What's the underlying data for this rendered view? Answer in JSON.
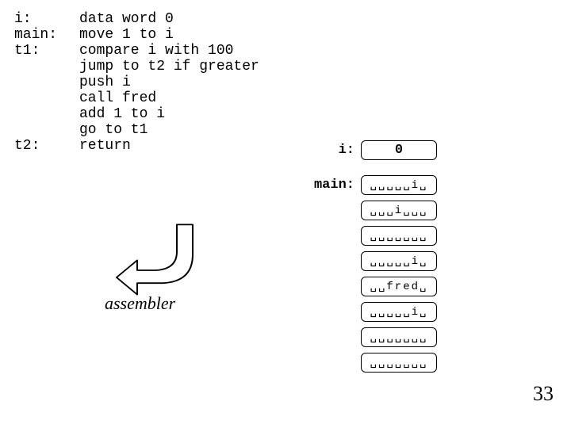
{
  "code": {
    "rows": [
      {
        "label": "i:",
        "instr": "data word 0"
      },
      {
        "label": "main:",
        "instr": "move 1 to i"
      },
      {
        "label": "t1:",
        "instr": "compare i with 100"
      },
      {
        "label": "",
        "instr": "jump to t2 if greater"
      },
      {
        "label": "",
        "instr": "push i"
      },
      {
        "label": "",
        "instr": "call fred"
      },
      {
        "label": "",
        "instr": "add 1 to i"
      },
      {
        "label": "",
        "instr": "go to t1"
      },
      {
        "label": "t2:",
        "instr": "return"
      }
    ]
  },
  "assembler_caption": "assembler",
  "memory": {
    "cells": [
      {
        "label": "i:",
        "content": "0",
        "first": true
      },
      {
        "label": "",
        "spacer": true
      },
      {
        "label": "main:",
        "content": "␣␣␣␣␣i␣"
      },
      {
        "label": "",
        "content": "␣␣␣i␣␣␣"
      },
      {
        "label": "",
        "content": "␣␣␣␣␣␣␣"
      },
      {
        "label": "",
        "content": "␣␣␣␣␣i␣"
      },
      {
        "label": "",
        "content": "␣␣fred␣"
      },
      {
        "label": "",
        "content": "␣␣␣␣␣i␣"
      },
      {
        "label": "",
        "content": "␣␣␣␣␣␣␣"
      },
      {
        "label": "",
        "content": "␣␣␣␣␣␣␣"
      }
    ]
  },
  "page_number": "33"
}
